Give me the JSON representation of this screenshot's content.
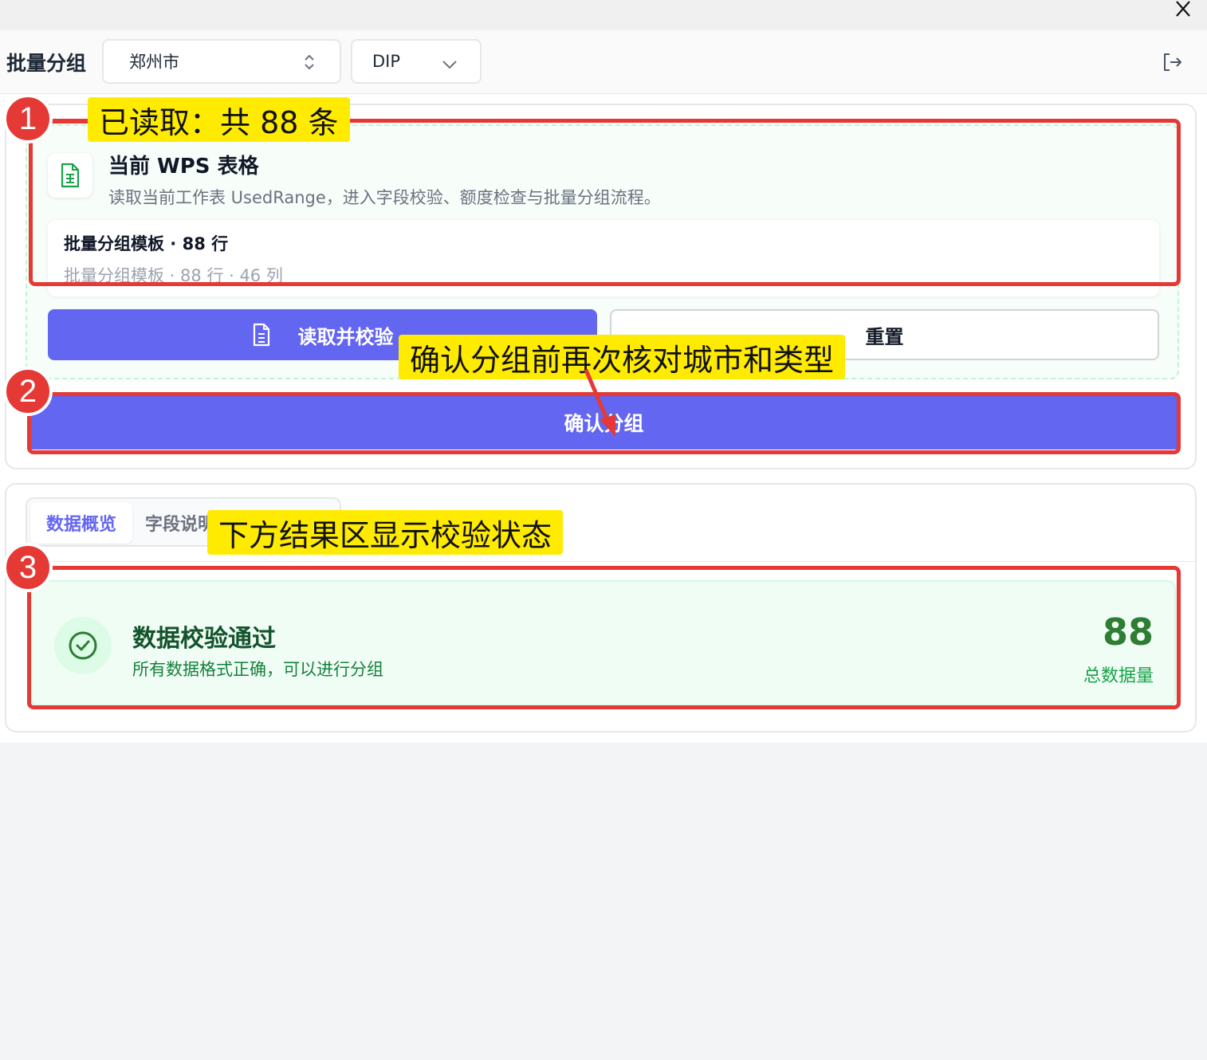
{
  "header": {
    "title": "批量分组",
    "city_select": "郑州市",
    "type_select": "DIP"
  },
  "import": {
    "source_title": "当前 WPS 表格",
    "source_desc": "读取当前工作表 UsedRange，进入字段校验、额度检查与批量分组流程。",
    "file_name": "批量分组模板 · 88 行",
    "file_meta": "批量分组模板 · 88 行 · 46 列",
    "read_button": "读取并校验",
    "reset_button": "重置",
    "confirm_button": "确认分组"
  },
  "results": {
    "tabs": [
      "数据概览",
      "字段说明"
    ],
    "status_title": "数据校验通过",
    "status_desc": "所有数据格式正确，可以进行分组",
    "count": "88",
    "count_label": "总数据量"
  },
  "annotations": {
    "badge1": "1",
    "badge2": "2",
    "badge3": "3",
    "callout1": "已读取：共 88 条",
    "callout2": "确认分组前再次核对城市和类型",
    "callout3": "下方结果区显示校验状态"
  },
  "colors": {
    "primary": "#6366f1",
    "success": "#2e7d32",
    "annotation_red": "#e53935",
    "callout_yellow": "#ffeb00"
  },
  "icons": [
    "close-icon",
    "chevron-up-down-icon",
    "chevron-down-icon",
    "logout-icon",
    "spreadsheet-icon",
    "document-icon",
    "check-circle-icon"
  ]
}
